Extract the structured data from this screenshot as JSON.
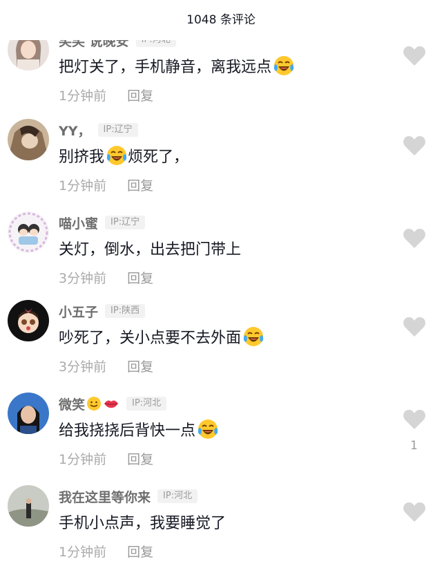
{
  "header": {
    "title": "1048 条评论"
  },
  "comments": [
    {
      "name": "笑笑 说晚安",
      "ip": "IP:河北",
      "text": "把灯关了，手机静音，离我远点",
      "emoji": "laughing-crying-emoji",
      "time": "1分钟前",
      "reply": "回复",
      "likes": ""
    },
    {
      "name": "YY，",
      "ip": "IP:辽宁",
      "text_before": "别挤我",
      "text_after": "烦死了，",
      "emoji": "laughing-crying-emoji",
      "time": "1分钟前",
      "reply": "回复",
      "likes": ""
    },
    {
      "name": "喵小蜜",
      "ip": "IP:辽宁",
      "text": "关灯，倒水，出去把门带上",
      "time": "3分钟前",
      "reply": "回复",
      "likes": ""
    },
    {
      "name": "小五子",
      "ip": "IP:陕西",
      "text": "吵死了，关小点要不去外面",
      "emoji": "laughing-crying-emoji",
      "time": "3分钟前",
      "reply": "回复",
      "likes": ""
    },
    {
      "name": "微笑",
      "name_emojis": [
        "smile-emoji",
        "lips-emoji"
      ],
      "ip": "IP:河北",
      "text": "给我挠挠后背快一点",
      "emoji": "laughing-crying-emoji",
      "time": "1分钟前",
      "reply": "回复",
      "likes": "1"
    },
    {
      "name": "我在这里等你来",
      "ip": "IP:河北",
      "text": "手机小点声，我要睡觉了",
      "time": "1分钟前",
      "reply": "回复",
      "likes": ""
    }
  ],
  "colors": {
    "name": "#6e6e6e",
    "meta": "#aaaaaa",
    "heart": "#d5d5d5",
    "text": "#161823"
  }
}
